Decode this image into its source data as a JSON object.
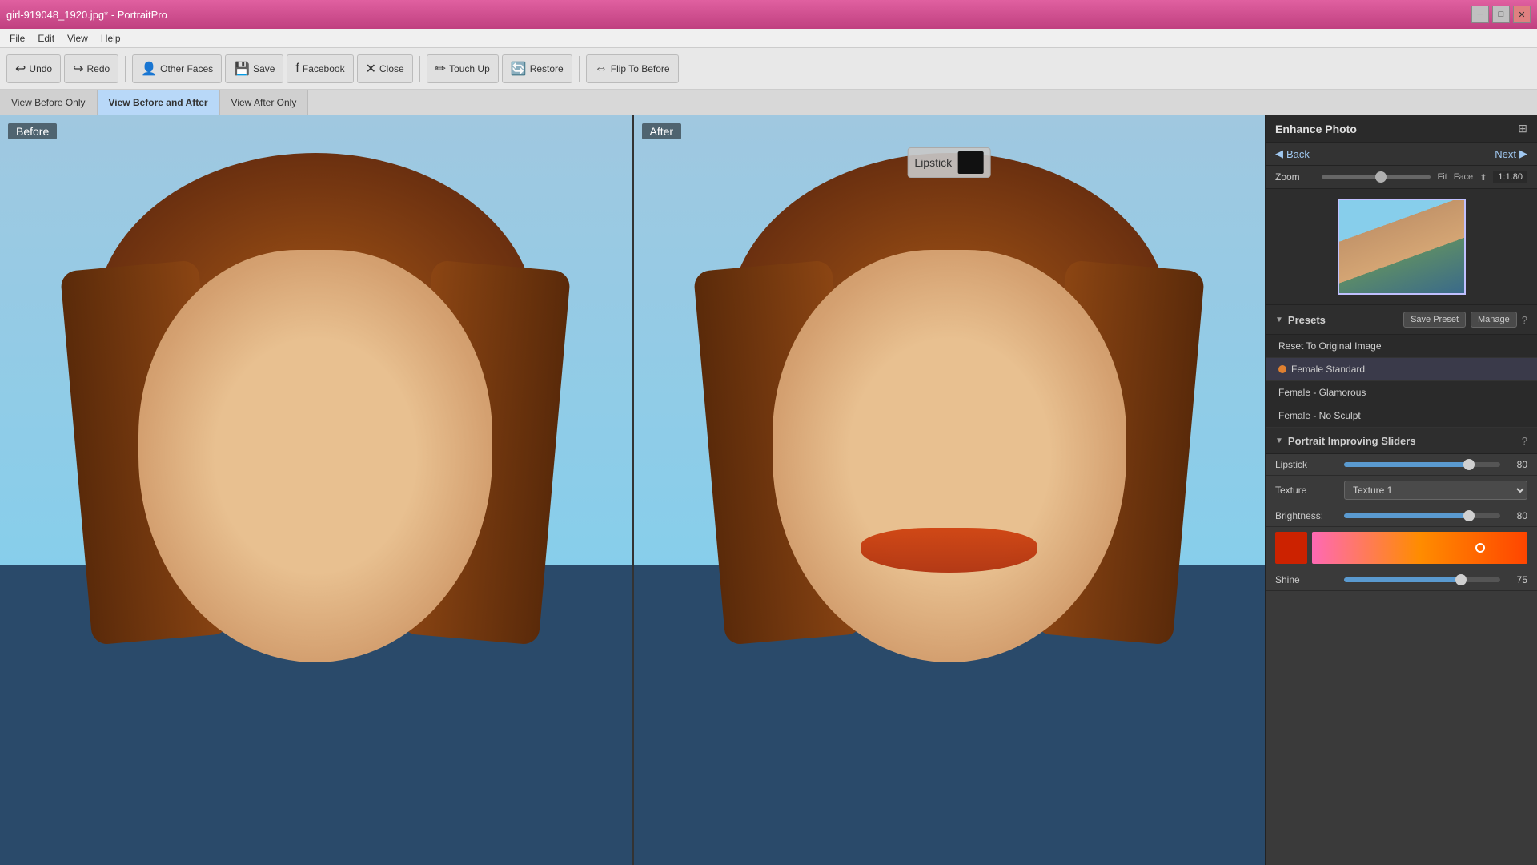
{
  "titlebar": {
    "title": "girl-919048_1920.jpg* - PortraitPro",
    "minimize_label": "─",
    "maximize_label": "□",
    "close_label": "✕"
  },
  "menubar": {
    "items": [
      "File",
      "Edit",
      "View",
      "Help"
    ]
  },
  "toolbar": {
    "undo_label": "Undo",
    "redo_label": "Redo",
    "other_faces_label": "Other Faces",
    "save_label": "Save",
    "facebook_label": "Facebook",
    "close_label": "Close",
    "touch_up_label": "Touch Up",
    "restore_label": "Restore",
    "flip_to_before_label": "Flip To Before"
  },
  "view_modes": {
    "before_only": "View Before Only",
    "before_and_after": "View Before and After",
    "after_only": "View After Only"
  },
  "panels": {
    "before_label": "Before",
    "after_label": "After"
  },
  "lipstick_tooltip": {
    "label": "Lipstick"
  },
  "right_panel": {
    "enhance_photo_title": "Enhance Photo",
    "back_label": "Back",
    "next_label": "Next",
    "zoom_label": "Zoom",
    "zoom_fit": "Fit",
    "zoom_face": "Face",
    "zoom_ratio": "1:1.80",
    "presets_section_title": "Presets",
    "save_preset_label": "Save Preset",
    "manage_label": "Manage",
    "presets": [
      {
        "name": "Reset To Original Image",
        "active": false
      },
      {
        "name": "Female Standard",
        "active": true
      },
      {
        "name": "Female - Glamorous",
        "active": false
      },
      {
        "name": "Female - No Sculpt",
        "active": false
      }
    ],
    "portrait_sliders_title": "Portrait Improving Sliders",
    "lipstick_label": "Lipstick",
    "lipstick_value": "80",
    "texture_label": "Texture",
    "texture_value": "Texture 1",
    "brightness_label": "Brightness:",
    "brightness_value": "80",
    "shine_label": "Shine",
    "shine_value": "75"
  }
}
